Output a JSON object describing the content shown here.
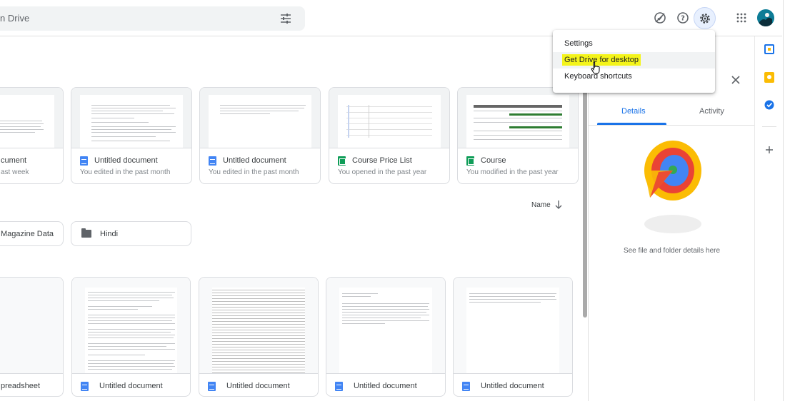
{
  "search": {
    "placeholder": "n Drive"
  },
  "colors": {
    "accent": "#1a73e8",
    "doc": "#4285f4",
    "sheet": "#0f9d58",
    "highlight": "#f4f41a"
  },
  "topbar_icons": [
    "tune-icon",
    "offline-status-icon",
    "help-icon",
    "settings-icon",
    "apps-grid-icon"
  ],
  "recent_files": [
    {
      "title": "cument",
      "subtitle": "ast week",
      "icon": "doc"
    },
    {
      "title": "Untitled document",
      "subtitle": "You edited in the past month",
      "icon": "doc"
    },
    {
      "title": "Untitled document",
      "subtitle": "You edited in the past month",
      "icon": "doc"
    },
    {
      "title": "Course Price List",
      "subtitle": "You opened in the past year",
      "icon": "sheet"
    },
    {
      "title": "Course",
      "subtitle": "You modified in the past year",
      "icon": "sheet"
    }
  ],
  "sort": {
    "label": "Name"
  },
  "folders": [
    {
      "name": "Magazine Data"
    },
    {
      "name": "Hindi"
    }
  ],
  "files": [
    {
      "title": "preadsheet"
    },
    {
      "title": "Untitled document"
    },
    {
      "title": "Untitled document"
    },
    {
      "title": "Untitled document"
    },
    {
      "title": "Untitled document"
    }
  ],
  "details_panel": {
    "tabs": [
      "Details",
      "Activity"
    ],
    "hint": "See file and folder details here"
  },
  "settings_menu": {
    "items": [
      "Settings",
      "Get Drive for desktop",
      "Keyboard shortcuts"
    ]
  }
}
